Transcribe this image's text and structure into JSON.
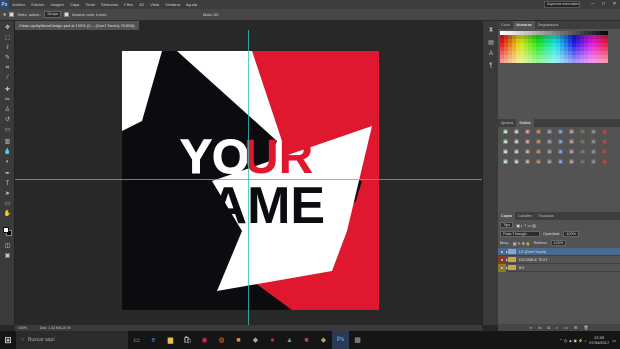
{
  "app": {
    "logo": "Ps",
    "menu": [
      "Archivo",
      "Edición",
      "Imagen",
      "Capa",
      "Texto",
      "Selección",
      "Filtro",
      "3D",
      "Vista",
      "Ventana",
      "Ayuda"
    ],
    "workspace": "Aspectos esenciales",
    "window_controls": [
      "–",
      "□",
      "✕"
    ]
  },
  "options_bar": {
    "sample_label": "Selec. autom.:",
    "sample_value": "Grupo",
    "transform_label": "Mostrar contr. transf.",
    "mode_label": "Modo 3D:"
  },
  "document": {
    "tab": "Clean-updtyNeonDesign.psd al 100% (C... (Don't Touch), RGB/8)",
    "zoom": "100%",
    "doc_size": "Doc: 1,43 M/6,24 M"
  },
  "artwork": {
    "line1_a": "YO",
    "line1_b": "UR",
    "line2": "NAME",
    "colors": {
      "red": "#e0182f",
      "black": "#0c0b10",
      "white": "#ffffff"
    }
  },
  "panels": {
    "top_tabs": [
      "Color",
      "Muestras",
      "Degradados"
    ],
    "adj_tabs": [
      "Ajustes",
      "Estilos"
    ],
    "layers_tabs": [
      "Capas",
      "Canales",
      "Trazados"
    ],
    "kind_label": "Tipo",
    "blend_mode": "Pass Through",
    "opacity_label": "Opacidad:",
    "opacity_value": "100%",
    "lock_label": "Bloq.:",
    "fill_label": "Relleno:",
    "fill_value": "100%",
    "layers": [
      {
        "name": "LS (Dont Touch)",
        "selected": true
      },
      {
        "name": "EDITABLE TEXT",
        "selected": false
      },
      {
        "name": "BG",
        "selected": false
      }
    ]
  },
  "taskbar": {
    "search_placeholder": "Buscar aquí",
    "time": "22:05",
    "date": "07/04/2017"
  },
  "icons": [
    "search-icon",
    "windows-start-icon",
    "edge-icon",
    "folder-icon",
    "chrome-icon",
    "photoshop-icon"
  ]
}
